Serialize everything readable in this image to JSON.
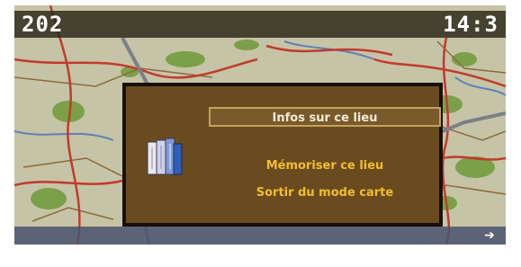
{
  "top_bar": {
    "road_number": "202",
    "road_name": "",
    "clock": "14:3"
  },
  "dialog": {
    "icon": "book-icon",
    "menu_items": [
      {
        "label": "Infos sur ce lieu",
        "state": "selected"
      },
      {
        "label": "",
        "state": "disabled"
      },
      {
        "label": "Mémoriser ce lieu",
        "state": "enabled"
      },
      {
        "label": "Sortir du mode carte",
        "state": "enabled"
      }
    ]
  },
  "bottom_bar": {
    "left_label": "",
    "right_label": "",
    "arrow_icon": "right-arrow-icon"
  },
  "colors": {
    "dialog_bg": "#6a4b20",
    "menu_text": "#f0be2d",
    "selected_text": "#f3ecd8",
    "map_bg": "#c6c4a6",
    "road_red": "#c23a2c"
  }
}
